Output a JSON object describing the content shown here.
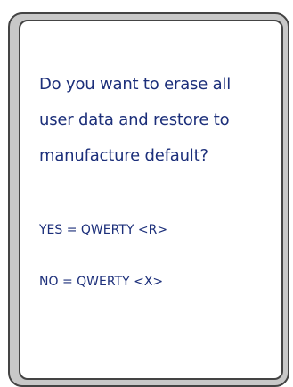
{
  "dialog": {
    "prompt": "Do you want to erase all user data and restore to manufacture default?",
    "yes_option": "YES = QWERTY <R>",
    "no_option": "NO = QWERTY <X>"
  },
  "colors": {
    "text": "#1c2f7a",
    "frame": "#c8c8c8",
    "border": "#444444",
    "screen": "#ffffff"
  }
}
